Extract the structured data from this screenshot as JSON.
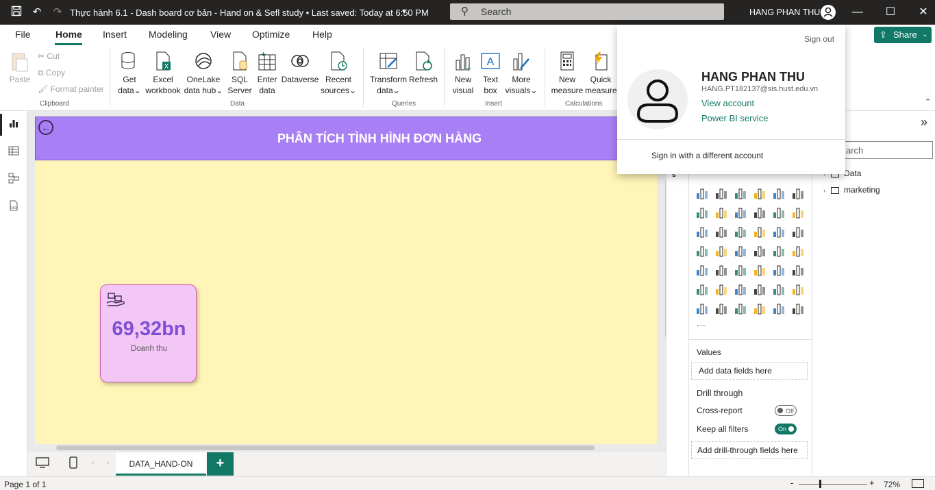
{
  "titlebar": {
    "doc_title": "Thực hành 6.1 - Dash board cơ bản - Hand on & Sefl study • Last saved: Today at 6:50 PM",
    "search_placeholder": "Search",
    "user_name": "HANG PHAN THU"
  },
  "menu": {
    "tabs": [
      "File",
      "Home",
      "Insert",
      "Modeling",
      "View",
      "Optimize",
      "Help"
    ],
    "active_tab": "Home",
    "share_label": "Share"
  },
  "ribbon": {
    "clipboard": {
      "paste": "Paste",
      "cut": "Cut",
      "copy": "Copy",
      "format_painter": "Format painter",
      "group": "Clipboard"
    },
    "data": {
      "get_data": [
        "Get",
        "data"
      ],
      "excel": [
        "Excel",
        "workbook"
      ],
      "onelake": [
        "OneLake",
        "data hub"
      ],
      "sql": [
        "SQL",
        "Server"
      ],
      "enter": [
        "Enter",
        "data"
      ],
      "dataverse": "Dataverse",
      "recent": [
        "Recent",
        "sources"
      ],
      "group": "Data"
    },
    "queries": {
      "transform": [
        "Transform",
        "data"
      ],
      "refresh": "Refresh",
      "group": "Queries"
    },
    "insert": {
      "new_visual": [
        "New",
        "visual"
      ],
      "text_box": [
        "Text",
        "box"
      ],
      "more_visuals": [
        "More",
        "visuals"
      ],
      "group": "Insert"
    },
    "calculations": {
      "new_measure": [
        "New",
        "measure"
      ],
      "quick_measure": [
        "Quick",
        "measure"
      ],
      "group": "Calculations"
    }
  },
  "report": {
    "title": "PHÂN TÍCH TÌNH HÌNH ĐƠN HÀNG",
    "kpi_value": "69,32bn",
    "kpi_label": "Doanh thu"
  },
  "pages": {
    "tab": "DATA_HAND-ON",
    "add": "+"
  },
  "viz_pane": {
    "values_title": "Values",
    "values_well": "Add data fields here",
    "drill_title": "Drill through",
    "cross_report": "Cross-report",
    "cross_report_state": "Off",
    "keep_filters": "Keep all filters",
    "keep_filters_state": "On",
    "drill_well": "Add drill-through fields here",
    "more": "···"
  },
  "data_pane": {
    "search_placeholder": "arch",
    "tables": [
      "Data",
      "marketing"
    ]
  },
  "account_popup": {
    "sign_out": "Sign out",
    "name": "HANG PHAN THU",
    "email": "HANG.PT182137@sis.hust.edu.vn",
    "view_account": "View account",
    "power_bi_service": "Power BI service",
    "different_account": "Sign in with a different account"
  },
  "status": {
    "page": "Page 1 of 1",
    "zoom": "72%"
  },
  "colors": {
    "accent": "#117865",
    "header": "#a97ff5",
    "canvas": "#fff5b8",
    "card": "#f2c6f5",
    "kpi": "#7e4fd4"
  }
}
